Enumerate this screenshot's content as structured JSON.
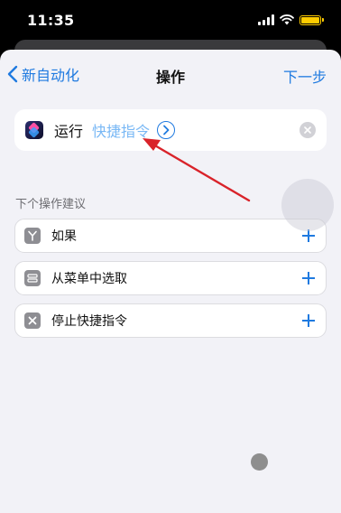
{
  "status_bar": {
    "time": "11:35",
    "battery_color": "#ffcc00"
  },
  "nav": {
    "back_label": "新自动化",
    "title": "操作",
    "next_label": "下一步"
  },
  "action": {
    "verb": "运行",
    "parameter": "快捷指令"
  },
  "suggestions": {
    "header": "下个操作建议",
    "items": [
      {
        "label": "如果",
        "icon": "branch-icon"
      },
      {
        "label": "从菜单中选取",
        "icon": "menu-icon"
      },
      {
        "label": "停止快捷指令",
        "icon": "stop-icon"
      }
    ]
  },
  "colors": {
    "accent": "#1f7ae0",
    "parameter": "#79b8f5",
    "annotation_arrow": "#d9232a",
    "sheet_bg": "#f2f2f7"
  }
}
